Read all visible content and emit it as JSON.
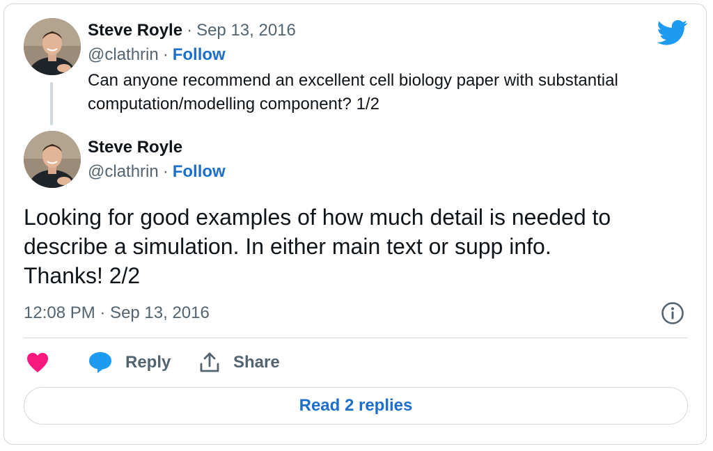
{
  "reply_tweet": {
    "display_name": "Steve Royle",
    "date": "Sep 13, 2016",
    "handle": "@clathrin",
    "follow_label": "Follow",
    "separator": "·",
    "text": "Can anyone recommend an excellent cell biology paper with substantial computation/modelling component? 1/2"
  },
  "main_tweet": {
    "display_name": "Steve Royle",
    "handle": "@clathrin",
    "follow_label": "Follow",
    "separator": "·",
    "text_lines": [
      "Looking for good examples of how much detail is needed to",
      "describe a simulation. In either main text or supp info.",
      "Thanks! 2/2"
    ],
    "timestamp": "12:08 PM · Sep 13, 2016"
  },
  "actions": {
    "like_label": "",
    "reply_label": "Reply",
    "share_label": "Share",
    "read_replies_label": "Read 2 replies"
  },
  "icons": {
    "brand": "twitter-bird-icon",
    "info": "info-icon",
    "like": "heart-icon",
    "reply": "speech-bubble-icon",
    "share": "share-upload-icon"
  },
  "colors": {
    "accent": "#1d9bf0",
    "link": "#1d6fcc",
    "heart": "#f91880",
    "muted": "#536471",
    "border": "#cfd9de"
  }
}
